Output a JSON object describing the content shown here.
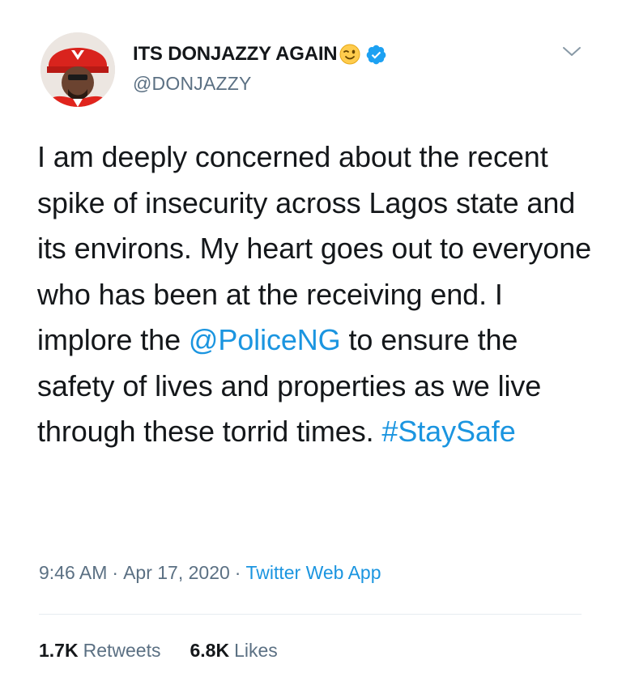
{
  "author": {
    "display_name": "ITS DONJAZZY AGAIN",
    "handle": "@DONJAZZY",
    "verified": true,
    "emoji_icon": "winking-face-icon",
    "verified_icon": "verified-badge-icon",
    "avatar_icon": "profile-photo"
  },
  "tweet": {
    "text_part1": "I am deeply concerned about the recent spike of insecurity across Lagos state and its environs. My heart goes out to everyone who has been at the receiving end. I implore the ",
    "mention": "@PoliceNG",
    "text_part2": " to ensure the safety of lives and properties as we live through these torrid times. ",
    "hashtag": "#StaySafe"
  },
  "meta": {
    "time": "9:46 AM",
    "separator": "·",
    "date": "Apr 17, 2020",
    "app": "Twitter Web App"
  },
  "stats": {
    "retweets_count": "1.7K",
    "retweets_label": "Retweets",
    "likes_count": "6.8K",
    "likes_label": "Likes"
  },
  "colors": {
    "link_blue": "#1b95e0",
    "secondary_gray": "#5b7083",
    "text_dark": "#14171a",
    "verified_blue": "#1da1f2"
  },
  "menu_icon": "chevron-down-icon"
}
